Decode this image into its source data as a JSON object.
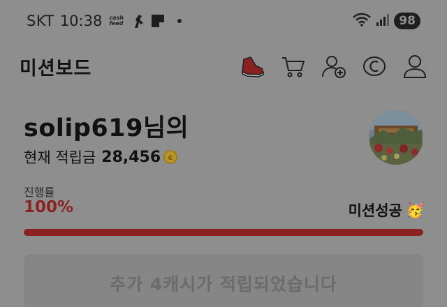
{
  "status_bar": {
    "carrier": "SKT",
    "time": "10:38",
    "app_badge": "cash feed",
    "battery": "98",
    "icons": [
      "cashfeed-icon",
      "shoe-notification-icon",
      "note-icon",
      "dot-icon",
      "wifi-icon",
      "signal-icon",
      "battery-icon"
    ]
  },
  "header": {
    "title": "미션보드",
    "icons": [
      "sneaker-icon",
      "cart-icon",
      "add-friend-icon",
      "cash-coin-icon",
      "profile-icon"
    ]
  },
  "profile": {
    "username": "solip619님의",
    "points_label": "현재 적립금",
    "points_value": "28,456",
    "coin_symbol": "c"
  },
  "progress": {
    "label": "진행률",
    "value_text": "100%",
    "fraction": 1.0,
    "status": "미션성공",
    "status_emoji": "🥳"
  },
  "banner": {
    "text": "추가 4캐시가 적립되었습니다"
  },
  "colors": {
    "accent": "#8b2222",
    "overlay_bg": "#8e8e8e"
  }
}
